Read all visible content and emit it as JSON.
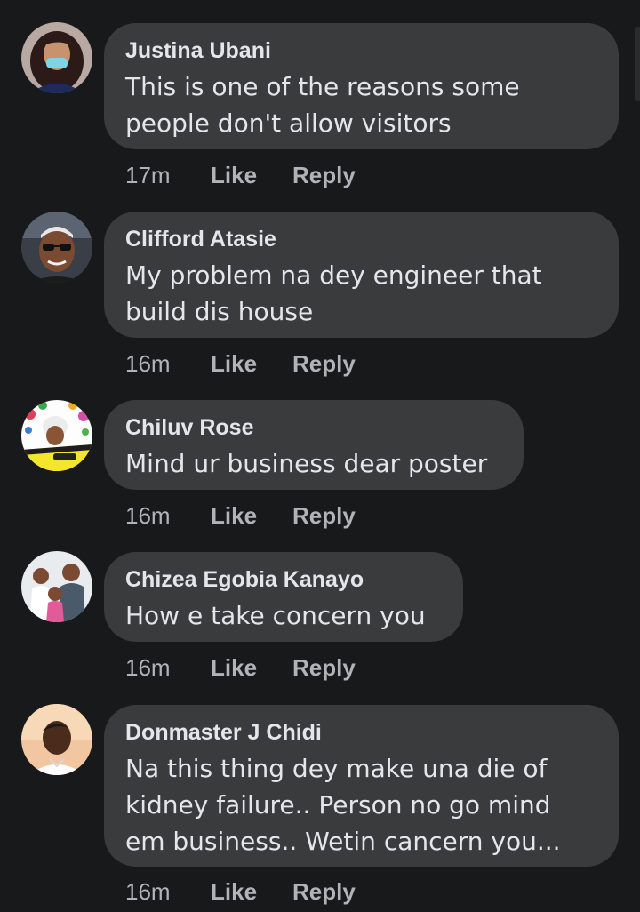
{
  "colors": {
    "background": "#18191a",
    "bubble": "#3a3b3c",
    "primary_text": "#e4e6eb",
    "secondary_text": "#b0b3b8"
  },
  "comments": [
    {
      "author": "Justina Ubani",
      "text": "This is one of the reasons some\npeople don't allow visitors",
      "time": "17m",
      "like_label": "Like",
      "reply_label": "Reply",
      "avatar_icon": "profile-photo-woman"
    },
    {
      "author": "Clifford Atasie",
      "text": "My problem na dey engineer that\nbuild dis house",
      "time": "16m",
      "like_label": "Like",
      "reply_label": "Reply",
      "avatar_icon": "profile-photo-man-sunglasses"
    },
    {
      "author": "Chiluv Rose",
      "text": "Mind ur business dear poster",
      "time": "16m",
      "like_label": "Like",
      "reply_label": "Reply",
      "avatar_icon": "profile-photo-floral-frame"
    },
    {
      "author": "Chizea Egobia Kanayo",
      "text": "How e take concern you",
      "time": "16m",
      "like_label": "Like",
      "reply_label": "Reply",
      "avatar_icon": "profile-photo-family"
    },
    {
      "author": "Donmaster J Chidi",
      "text": "Na this thing dey make una die of\nkidney failure.. Person no go mind\nem business.. Wetin cancern you...",
      "time": "16m",
      "like_label": "Like",
      "reply_label": "Reply",
      "avatar_icon": "profile-photo-man"
    }
  ]
}
